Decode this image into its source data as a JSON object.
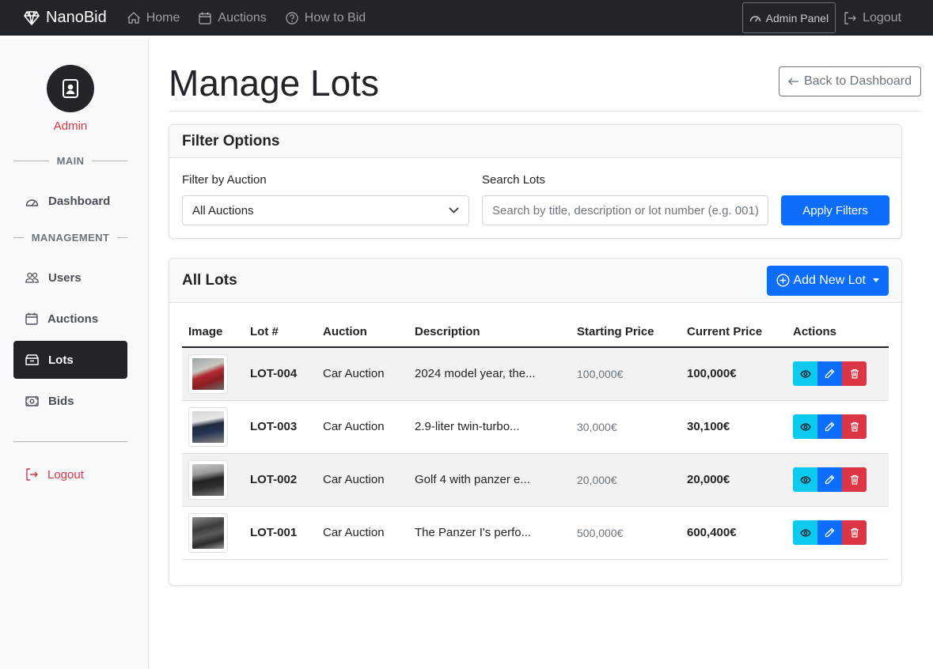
{
  "colors": {
    "dark": "#212529",
    "primary": "#0d6efd",
    "info": "#0dcaf0",
    "danger": "#dc3545",
    "muted": "#6c757d"
  },
  "navbar": {
    "brand": "NanoBid",
    "brand_icon": "gem-icon",
    "links": [
      {
        "label": "Home",
        "icon": "home-icon"
      },
      {
        "label": "Auctions",
        "icon": "calendar-icon"
      },
      {
        "label": "How to Bid",
        "icon": "question-circle-icon"
      }
    ],
    "admin_panel": "Admin Panel",
    "logout": "Logout"
  },
  "sidebar": {
    "user_name": "Admin",
    "section_main": "MAIN",
    "section_management": "MANAGEMENT",
    "items": [
      {
        "label": "Dashboard",
        "icon": "speedometer-icon"
      },
      {
        "label": "Users",
        "icon": "people-icon"
      },
      {
        "label": "Auctions",
        "icon": "calendar-icon"
      },
      {
        "label": "Lots",
        "icon": "box-icon",
        "active": true
      },
      {
        "label": "Bids",
        "icon": "cash-icon"
      }
    ],
    "logout": "Logout"
  },
  "page": {
    "title": "Manage Lots",
    "back_button": "Back to Dashboard"
  },
  "filters": {
    "header": "Filter Options",
    "auction_label": "Filter by Auction",
    "auction_selected": "All Auctions",
    "search_label": "Search Lots",
    "search_placeholder": "Search by title, description or lot number (e.g. 001)",
    "apply_button": "Apply Filters"
  },
  "lots": {
    "header": "All Lots",
    "add_button": "Add New Lot",
    "columns": [
      "Image",
      "Lot #",
      "Auction",
      "Description",
      "Starting Price",
      "Current Price",
      "Actions"
    ],
    "rows": [
      {
        "lot": "LOT-004",
        "auction": "Car Auction",
        "description": "2024 model year, the...",
        "starting": "100,000€",
        "current": "100,000€"
      },
      {
        "lot": "LOT-003",
        "auction": "Car Auction",
        "description": "2.9-liter twin-turbo...",
        "starting": "30,000€",
        "current": "30,100€"
      },
      {
        "lot": "LOT-002",
        "auction": "Car Auction",
        "description": "Golf 4 with panzer e...",
        "starting": "20,000€",
        "current": "20,000€"
      },
      {
        "lot": "LOT-001",
        "auction": "Car Auction",
        "description": "The Panzer I's perfo...",
        "starting": "500,000€",
        "current": "600,400€"
      }
    ]
  }
}
